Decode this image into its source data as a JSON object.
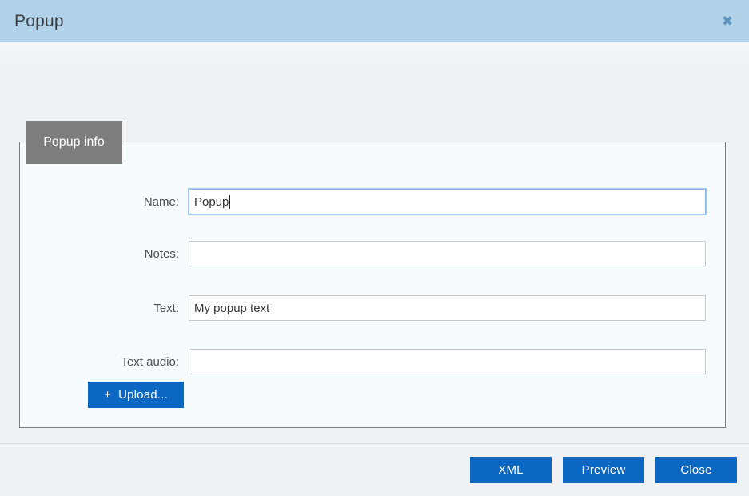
{
  "header": {
    "title": "Popup",
    "close_icon": "close-icon",
    "close_glyph": "✖",
    "background_color": "#b2d2ea"
  },
  "tab": {
    "label": "Popup info",
    "background_color": "#7d7d7d",
    "text_color": "#ffffff"
  },
  "form": {
    "fields": [
      {
        "label": "Name:",
        "value": "Popup",
        "placeholder": "",
        "focused": true,
        "name": "name-field"
      },
      {
        "label": "Notes:",
        "value": "",
        "placeholder": "",
        "focused": false,
        "name": "notes-field"
      },
      {
        "label": "Text:",
        "value": "My popup text",
        "placeholder": "",
        "focused": false,
        "name": "text-field"
      },
      {
        "label": "Text audio:",
        "value": "",
        "placeholder": "",
        "focused": false,
        "name": "text-audio-field"
      }
    ],
    "upload": {
      "label": "Upload...",
      "plus_glyph": "+",
      "icon": "plus-icon"
    }
  },
  "footer": {
    "buttons": [
      {
        "label": "XML",
        "name": "xml-button"
      },
      {
        "label": "Preview",
        "name": "preview-button"
      },
      {
        "label": "Close",
        "name": "close-button"
      }
    ],
    "accent_color": "#0b67c2"
  }
}
